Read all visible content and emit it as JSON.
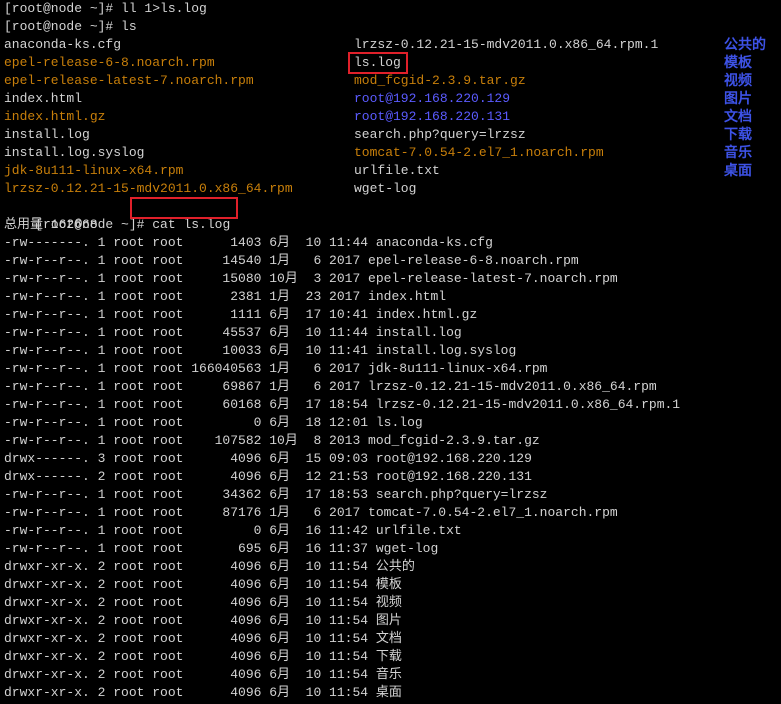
{
  "terminal": {
    "prompt_cmd1": "[root@node ~]# ll 1>ls.log",
    "prompt_cmd2": "[root@node ~]# ls",
    "prompt3_prefix": "[root@node ~]# ",
    "prompt3_cmd": "cat ls.log",
    "total": "总用量 162668",
    "ls_left": [
      {
        "text": "anaconda-ks.cfg",
        "color": "#d3d3d3"
      },
      {
        "text": "epel-release-6-8.noarch.rpm",
        "color": "#c87f0a"
      },
      {
        "text": "epel-release-latest-7.noarch.rpm",
        "color": "#c87f0a"
      },
      {
        "text": "index.html",
        "color": "#d3d3d3"
      },
      {
        "text": "index.html.gz",
        "color": "#c87f0a"
      },
      {
        "text": "install.log",
        "color": "#d3d3d3"
      },
      {
        "text": "install.log.syslog",
        "color": "#d3d3d3"
      },
      {
        "text": "jdk-8u111-linux-x64.rpm",
        "color": "#c87f0a"
      },
      {
        "text": "lrzsz-0.12.21-15-mdv2011.0.x86_64.rpm",
        "color": "#c87f0a"
      }
    ],
    "ls_right": [
      {
        "text": "lrzsz-0.12.21-15-mdv2011.0.x86_64.rpm.1",
        "color": "#d3d3d3"
      },
      {
        "text": "ls.log",
        "color": "#d3d3d3"
      },
      {
        "text": "mod_fcgid-2.3.9.tar.gz",
        "color": "#c87f0a"
      },
      {
        "text": "root@192.168.220.129",
        "color": "#5b5bff"
      },
      {
        "text": "root@192.168.220.131",
        "color": "#5b5bff"
      },
      {
        "text": "search.php?query=lrzsz",
        "color": "#d3d3d3"
      },
      {
        "text": "tomcat-7.0.54-2.el7_1.noarch.rpm",
        "color": "#c87f0a"
      },
      {
        "text": "urlfile.txt",
        "color": "#d3d3d3"
      },
      {
        "text": "wget-log",
        "color": "#d3d3d3"
      }
    ],
    "ls_dirs": [
      "公共的",
      "模板",
      "视频",
      "图片",
      "文档",
      "下载",
      "音乐",
      "桌面"
    ],
    "listing": [
      "-rw-------. 1 root root      1403 6月  10 11:44 anaconda-ks.cfg",
      "-rw-r--r--. 1 root root     14540 1月   6 2017 epel-release-6-8.noarch.rpm",
      "-rw-r--r--. 1 root root     15080 10月  3 2017 epel-release-latest-7.noarch.rpm",
      "-rw-r--r--. 1 root root      2381 1月  23 2017 index.html",
      "-rw-r--r--. 1 root root      1111 6月  17 10:41 index.html.gz",
      "-rw-r--r--. 1 root root     45537 6月  10 11:44 install.log",
      "-rw-r--r--. 1 root root     10033 6月  10 11:41 install.log.syslog",
      "-rw-r--r--. 1 root root 166040563 1月   6 2017 jdk-8u111-linux-x64.rpm",
      "-rw-r--r--. 1 root root     69867 1月   6 2017 lrzsz-0.12.21-15-mdv2011.0.x86_64.rpm",
      "-rw-r--r--. 1 root root     60168 6月  17 18:54 lrzsz-0.12.21-15-mdv2011.0.x86_64.rpm.1",
      "-rw-r--r--. 1 root root         0 6月  18 12:01 ls.log",
      "-rw-r--r--. 1 root root    107582 10月  8 2013 mod_fcgid-2.3.9.tar.gz",
      "drwx------. 3 root root      4096 6月  15 09:03 root@192.168.220.129",
      "drwx------. 2 root root      4096 6月  12 21:53 root@192.168.220.131",
      "-rw-r--r--. 1 root root     34362 6月  17 18:53 search.php?query=lrzsz",
      "-rw-r--r--. 1 root root     87176 1月   6 2017 tomcat-7.0.54-2.el7_1.noarch.rpm",
      "-rw-r--r--. 1 root root         0 6月  16 11:42 urlfile.txt",
      "-rw-r--r--. 1 root root       695 6月  16 11:37 wget-log",
      "drwxr-xr-x. 2 root root      4096 6月  10 11:54 公共的",
      "drwxr-xr-x. 2 root root      4096 6月  10 11:54 模板",
      "drwxr-xr-x. 2 root root      4096 6月  10 11:54 视频",
      "drwxr-xr-x. 2 root root      4096 6月  10 11:54 图片",
      "drwxr-xr-x. 2 root root      4096 6月  10 11:54 文档",
      "drwxr-xr-x. 2 root root      4096 6月  10 11:54 下载",
      "drwxr-xr-x. 2 root root      4096 6月  10 11:54 音乐",
      "drwxr-xr-x. 2 root root      4096 6月  10 11:54 桌面"
    ],
    "colors": {
      "background": "#000000",
      "text": "#d3d3d3",
      "archive": "#c87f0a",
      "directory": "#5b5bff",
      "side_label": "#3d52e6",
      "highlight": "#e0202a"
    }
  }
}
